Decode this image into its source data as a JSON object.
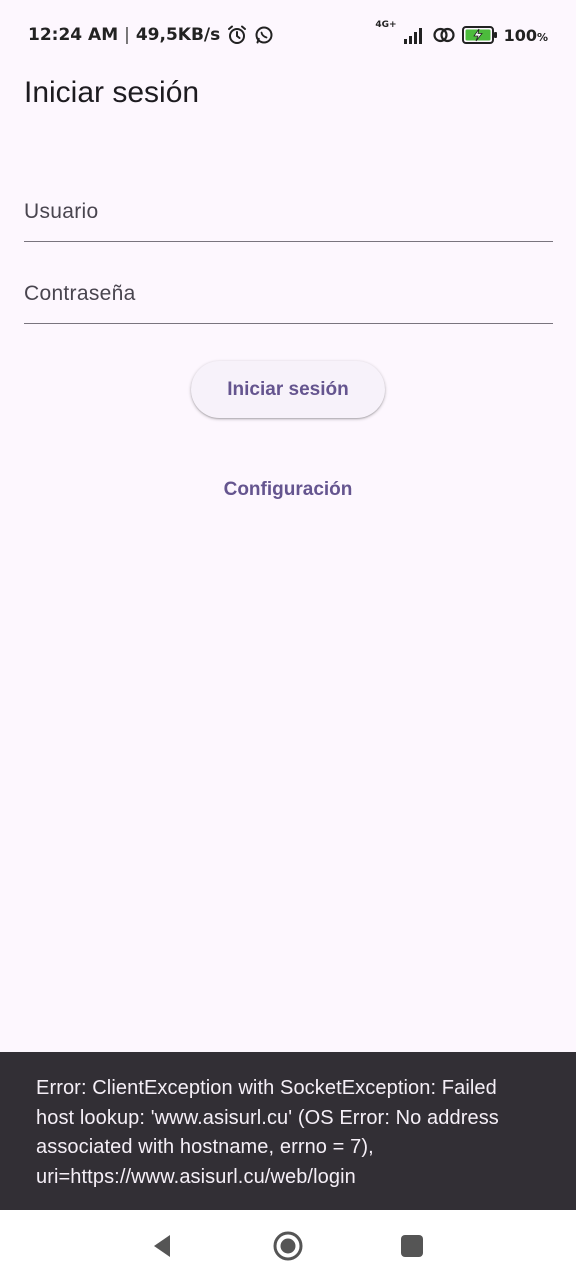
{
  "status_bar": {
    "time": "12:24 AM",
    "separator": "|",
    "speed": "49,5KB/s",
    "network_label": "4G+",
    "battery_percent": "100",
    "battery_unit": "%",
    "icons": [
      "alarm-icon",
      "whatsapp-icon",
      "signal-icon",
      "hotspot-icon",
      "battery-charging-icon"
    ]
  },
  "page": {
    "title": "Iniciar sesión"
  },
  "form": {
    "username_placeholder": "Usuario",
    "username_value": "",
    "password_placeholder": "Contraseña",
    "password_value": "",
    "login_button": "Iniciar sesión",
    "config_link": "Configuración"
  },
  "snackbar": {
    "message": "Error: ClientException with SocketException: Failed host lookup: 'www.asisurl.cu' (OS Error: No address associated with hostname, errno = 7), uri=https://www.asisurl.cu/web/login"
  },
  "nav_bar": {
    "icons": [
      "back-icon",
      "home-icon",
      "recents-icon"
    ]
  },
  "colors": {
    "background": "#fdf7fe",
    "accent": "#65558f",
    "snackbar_bg": "#322f35",
    "snackbar_text": "#f5eff7",
    "divider": "#79747e"
  }
}
